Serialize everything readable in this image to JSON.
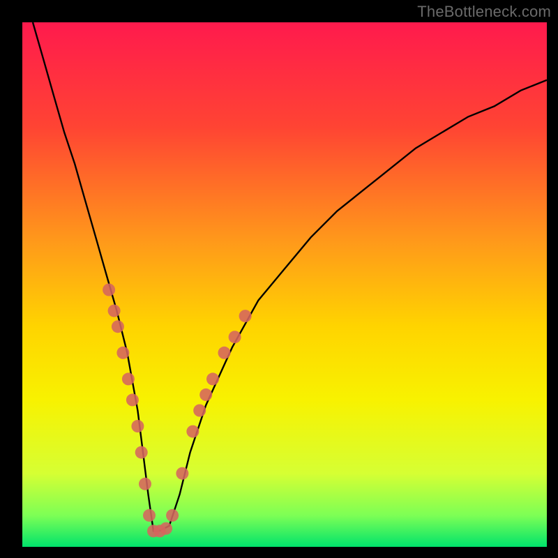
{
  "watermark": "TheBottleneck.com",
  "chart_data": {
    "type": "line",
    "title": "",
    "xlabel": "",
    "ylabel": "",
    "xlim": [
      0,
      100
    ],
    "ylim": [
      0,
      100
    ],
    "background_gradient": {
      "stops": [
        {
          "offset": 0,
          "color": "#ff1a4d"
        },
        {
          "offset": 20,
          "color": "#ff4433"
        },
        {
          "offset": 42,
          "color": "#ff9a1a"
        },
        {
          "offset": 58,
          "color": "#ffd400"
        },
        {
          "offset": 72,
          "color": "#f8f200"
        },
        {
          "offset": 86,
          "color": "#d6ff33"
        },
        {
          "offset": 94,
          "color": "#7dff55"
        },
        {
          "offset": 100,
          "color": "#00e36b"
        }
      ]
    },
    "series": [
      {
        "name": "bottleneck-curve",
        "color": "#000000",
        "x": [
          2,
          4,
          6,
          8,
          10,
          12,
          14,
          16,
          18,
          20,
          22,
          23,
          24,
          25,
          26,
          28,
          30,
          32,
          35,
          40,
          45,
          50,
          55,
          60,
          65,
          70,
          75,
          80,
          85,
          90,
          95,
          100
        ],
        "y": [
          100,
          93,
          86,
          79,
          73,
          66,
          59,
          52,
          45,
          37,
          26,
          18,
          10,
          3,
          3,
          4,
          10,
          18,
          27,
          38,
          47,
          53,
          59,
          64,
          68,
          72,
          76,
          79,
          82,
          84,
          87,
          89
        ]
      }
    ],
    "markers": {
      "name": "highlight-points",
      "color": "#d5655f",
      "radius": 9,
      "points": [
        {
          "x": 16.5,
          "y": 49
        },
        {
          "x": 17.5,
          "y": 45
        },
        {
          "x": 18.2,
          "y": 42
        },
        {
          "x": 19.2,
          "y": 37
        },
        {
          "x": 20.2,
          "y": 32
        },
        {
          "x": 21.0,
          "y": 28
        },
        {
          "x": 22.0,
          "y": 23
        },
        {
          "x": 22.7,
          "y": 18
        },
        {
          "x": 23.4,
          "y": 12
        },
        {
          "x": 24.2,
          "y": 6
        },
        {
          "x": 25.0,
          "y": 3
        },
        {
          "x": 26.2,
          "y": 3
        },
        {
          "x": 27.4,
          "y": 3.5
        },
        {
          "x": 28.6,
          "y": 6
        },
        {
          "x": 30.5,
          "y": 14
        },
        {
          "x": 32.5,
          "y": 22
        },
        {
          "x": 33.8,
          "y": 26
        },
        {
          "x": 35.0,
          "y": 29
        },
        {
          "x": 36.3,
          "y": 32
        },
        {
          "x": 38.5,
          "y": 37
        },
        {
          "x": 40.5,
          "y": 40
        },
        {
          "x": 42.5,
          "y": 44
        }
      ]
    }
  }
}
